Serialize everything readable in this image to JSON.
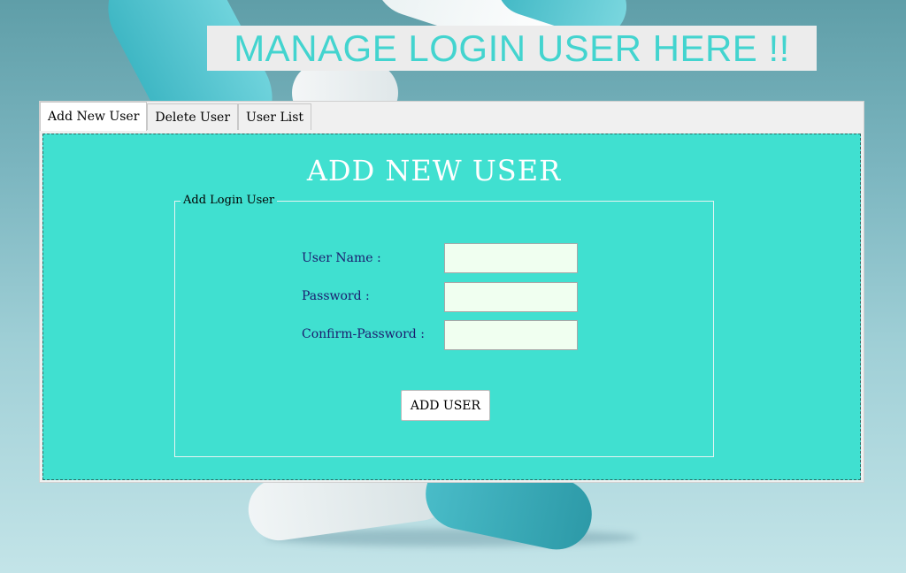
{
  "page": {
    "title": "MANAGE LOGIN USER HERE !!"
  },
  "tabs": [
    {
      "label": "Add New User",
      "active": true
    },
    {
      "label": "Delete User",
      "active": false
    },
    {
      "label": "User List",
      "active": false
    }
  ],
  "add_user_panel": {
    "heading": "ADD NEW USER",
    "group_label": "Add Login User",
    "fields": {
      "username": {
        "label": "User Name :",
        "value": ""
      },
      "password": {
        "label": "Password :",
        "value": ""
      },
      "confirm_password": {
        "label": "Confirm-Password :",
        "value": ""
      }
    },
    "submit_label": "ADD USER"
  },
  "colors": {
    "panel_bg": "#40e0d0",
    "title_text": "#43d4cf",
    "label_text": "#1b1b6e",
    "input_bg": "#f0fff0"
  }
}
